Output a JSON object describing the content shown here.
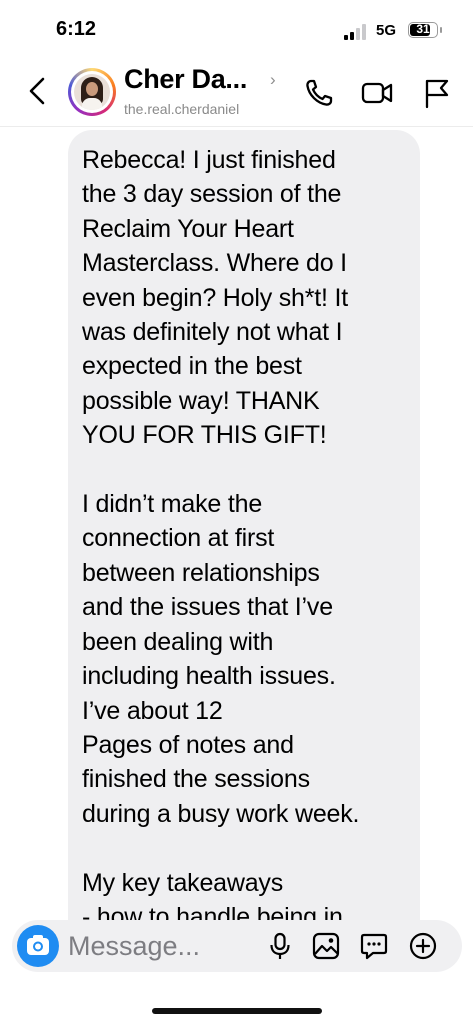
{
  "status_bar": {
    "time": "6:12",
    "network": "5G",
    "battery": "31"
  },
  "header": {
    "contact_name": "Cher Da...",
    "handle": "the.real.cherdaniel",
    "name_chevron": "›",
    "icons": [
      "back-arrow-icon",
      "phone-icon",
      "video-camera-icon",
      "flag-icon"
    ]
  },
  "message": {
    "text": "Rebecca! I just finished\nthe 3 day session of the\nReclaim Your Heart\nMasterclass. Where do I\neven begin? Holy sh*t! It\nwas definitely not what I\nexpected in the best\npossible way! THANK\nYOU FOR THIS GIFT!\n\nI didn’t make the\nconnection at first\nbetween relationships\nand the issues that I’ve\nbeen dealing with\nincluding health issues.\nI’ve about 12\nPages of notes and\nfinished the sessions\nduring a busy work week.\n\nMy key takeaways\n- how to handle being in"
  },
  "composer": {
    "placeholder": "Message...",
    "icons": [
      "camera-icon",
      "microphone-icon",
      "gallery-icon",
      "sticker-icon",
      "plus-icon"
    ]
  },
  "colors": {
    "accent": "#1f8cf2",
    "bubble": "#efeff1",
    "muted_text": "#8a8a8a"
  }
}
